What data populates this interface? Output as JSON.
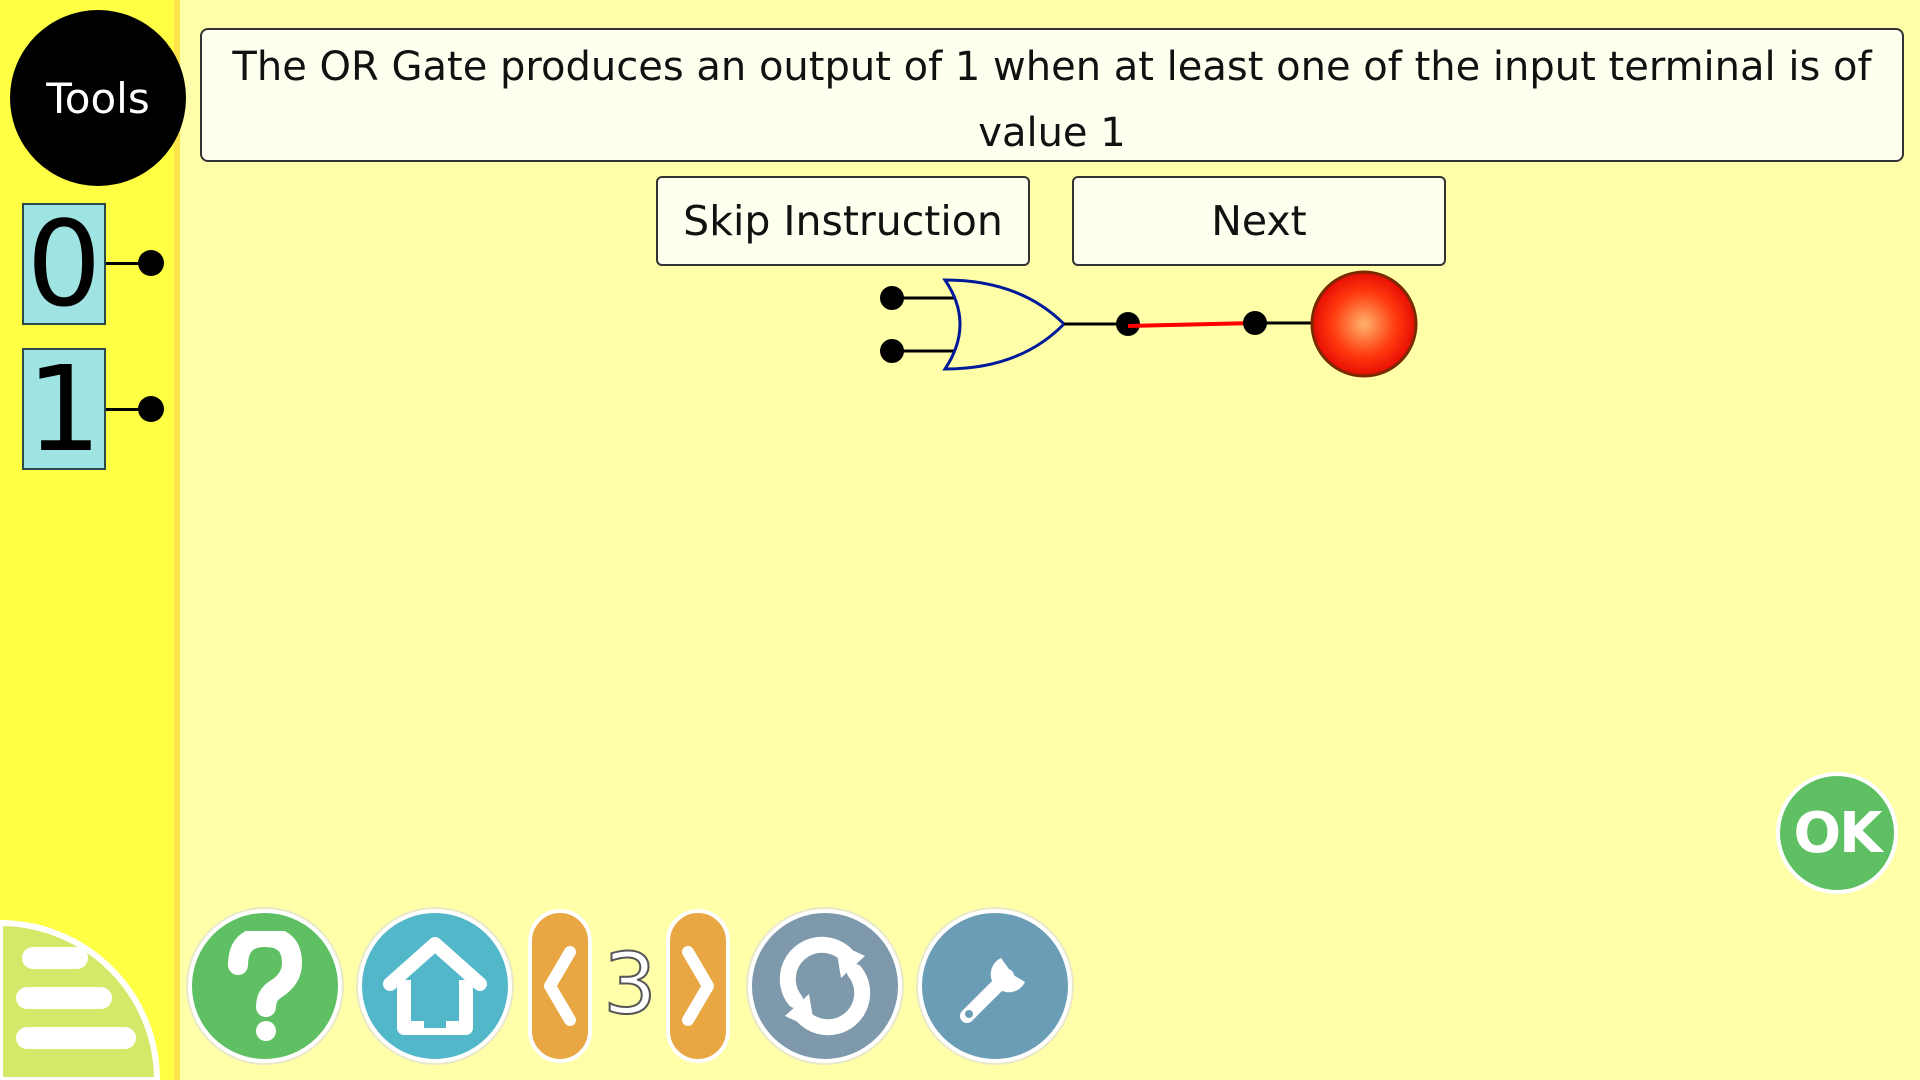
{
  "sidebar": {
    "tools_label": "Tools",
    "inputs": [
      {
        "label": "0"
      },
      {
        "label": "1"
      }
    ]
  },
  "instruction": {
    "text": "The OR Gate produces an output of 1 when at least one of the input terminal is of value 1"
  },
  "buttons": {
    "skip_label": "Skip Instruction",
    "next_label": "Next"
  },
  "circuit": {
    "gate_type": "OR",
    "gate_color": "#001a99",
    "wire_color": "#ff0000",
    "output_lamp_color": "#ff2a00"
  },
  "bottom_bar": {
    "menu_icon": "menu-icon",
    "help_icon": "help-icon",
    "home_icon": "home-icon",
    "level": "3",
    "reload_icon": "reload-icon",
    "settings_icon": "wrench-icon",
    "ok_label": "OK"
  },
  "colors": {
    "background": "#ffffaa",
    "sidebar": "#ffff44",
    "help": "#5fbf63",
    "home": "#52b7c8",
    "arrows": "#e9a743",
    "reload": "#7d99ab",
    "settings": "#6b9db6",
    "input_tile": "#9fe3e3"
  }
}
